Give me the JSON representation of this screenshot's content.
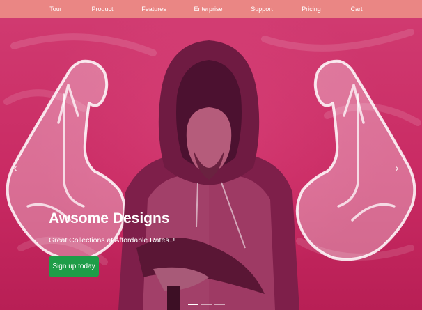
{
  "nav": {
    "items": [
      {
        "label": "Tour"
      },
      {
        "label": "Product"
      },
      {
        "label": "Features"
      },
      {
        "label": "Enterprise"
      },
      {
        "label": "Support"
      },
      {
        "label": "Pricing"
      },
      {
        "label": "Cart"
      }
    ]
  },
  "hero": {
    "title": "Awsome Designs",
    "subtitle": "Great Collections at Affordable Rates..!",
    "cta_label": "Sign up today",
    "prev_icon": "chevron-left-icon",
    "next_icon": "chevron-right-icon",
    "slides": [
      {
        "active": true
      },
      {
        "active": false
      },
      {
        "active": false
      }
    ]
  },
  "colors": {
    "navbar": "#ea8684",
    "hero_tint": "#c8235f",
    "cta": "#1e9d48",
    "text": "#ffffff"
  }
}
